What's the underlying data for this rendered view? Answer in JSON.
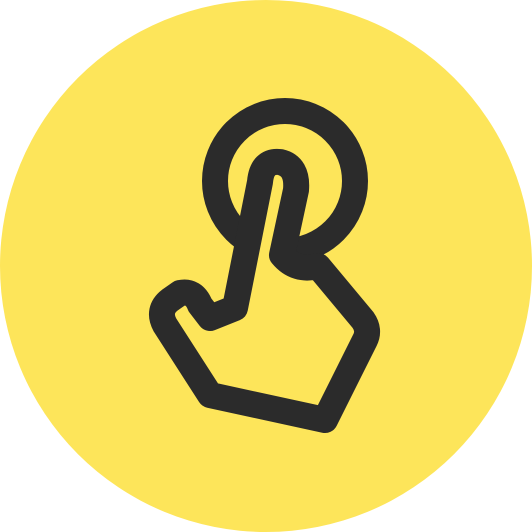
{
  "icon": {
    "name": "tap-gesture-icon",
    "background_shape": "circle",
    "background_color": "#FDE55A",
    "stroke_color": "#2B2B2B",
    "fill_color": "#FDE55A"
  }
}
